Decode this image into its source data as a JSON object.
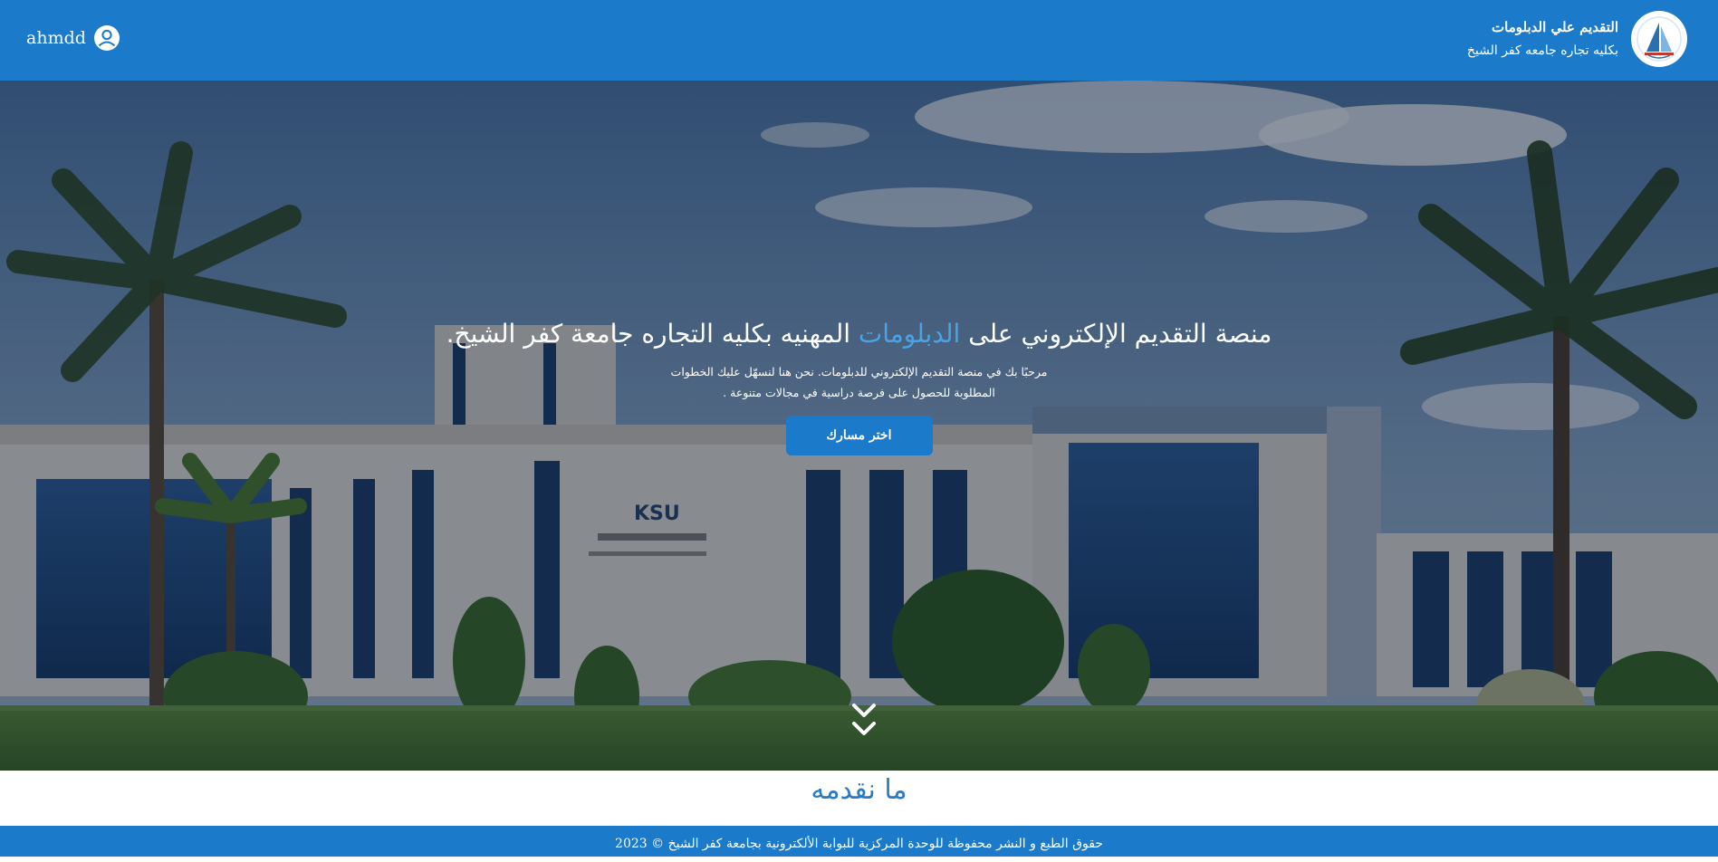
{
  "header": {
    "brand_title": "التقديم علي الدبلومات",
    "brand_subtitle": "بكليه تجاره جامعه كفر الشيخ",
    "logo_icon": "university-logo",
    "user_name": "ahmdd",
    "user_icon": "user-circle-icon"
  },
  "hero": {
    "title_before": "منصة التقديم الإلكتروني على",
    "title_accent": "الدبلومات",
    "title_after": "المهنيه بكليه التجاره جامعة كفر الشيخ.",
    "description": "مرحبًا بك في منصة التقديم الإلكتروني للدبلومات. نحن هنا لنسهّل عليك الخطوات المطلوبة للحصول على فرصة دراسية في مجالات متنوعة .",
    "cta_label": "اختر مسارك",
    "scroll_icon": "double-chevron-down-icon",
    "building_sign": "KSU"
  },
  "section": {
    "title": "ما نقدمه"
  },
  "footer": {
    "text": "حقوق الطبع و النشر محفوظة للوحدة المركزية للبوابة الألكترونية بجامعة كفر الشيخ © 2023"
  },
  "colors": {
    "primary": "#1b7ac9",
    "accent": "#4aa3e6",
    "section_title": "#2a7bc1"
  }
}
